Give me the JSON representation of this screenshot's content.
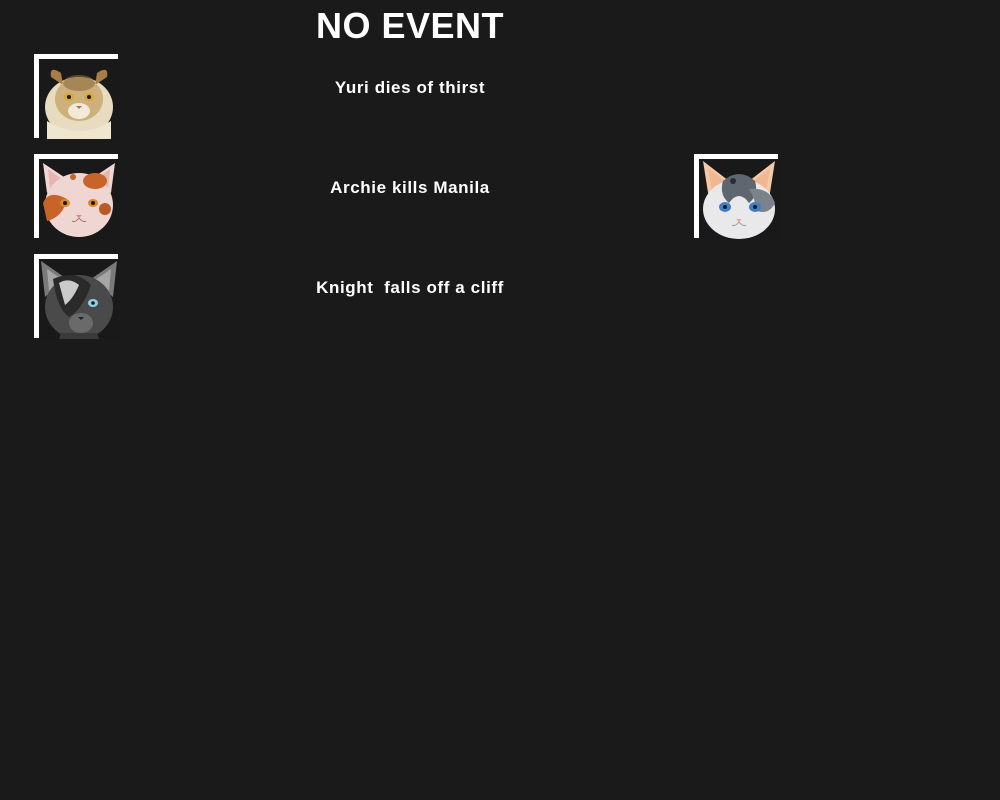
{
  "header": {
    "title": "NO EVENT"
  },
  "events": [
    {
      "text": "Yuri dies of thirst",
      "left_cat": {
        "icon": "cream-lion-cat-portrait-icon",
        "fur": "#d8c59a",
        "accent": "#8a6a3a",
        "eyes": "#d9a830"
      },
      "right_cat": null
    },
    {
      "text": "Archie kills Manila",
      "left_cat": {
        "icon": "calico-cat-portrait-icon",
        "fur": "#f0d6d2",
        "accent": "#c8642a",
        "eyes": "#d9892a"
      },
      "right_cat": {
        "icon": "gray-white-cat-portrait-icon",
        "fur": "#e9e9ec",
        "accent": "#5e6670",
        "eyes": "#3f7fc8"
      }
    },
    {
      "text": "Knight  falls off a cliff",
      "left_cat": {
        "icon": "dark-gray-cat-portrait-icon",
        "fur": "#4a4a4a",
        "accent": "#1f1f1f",
        "eyes": "#8fd0e8"
      },
      "right_cat": null
    }
  ],
  "colors": {
    "background": "#1a1a1a",
    "frame": "#ffffff",
    "text": "#ffffff"
  }
}
